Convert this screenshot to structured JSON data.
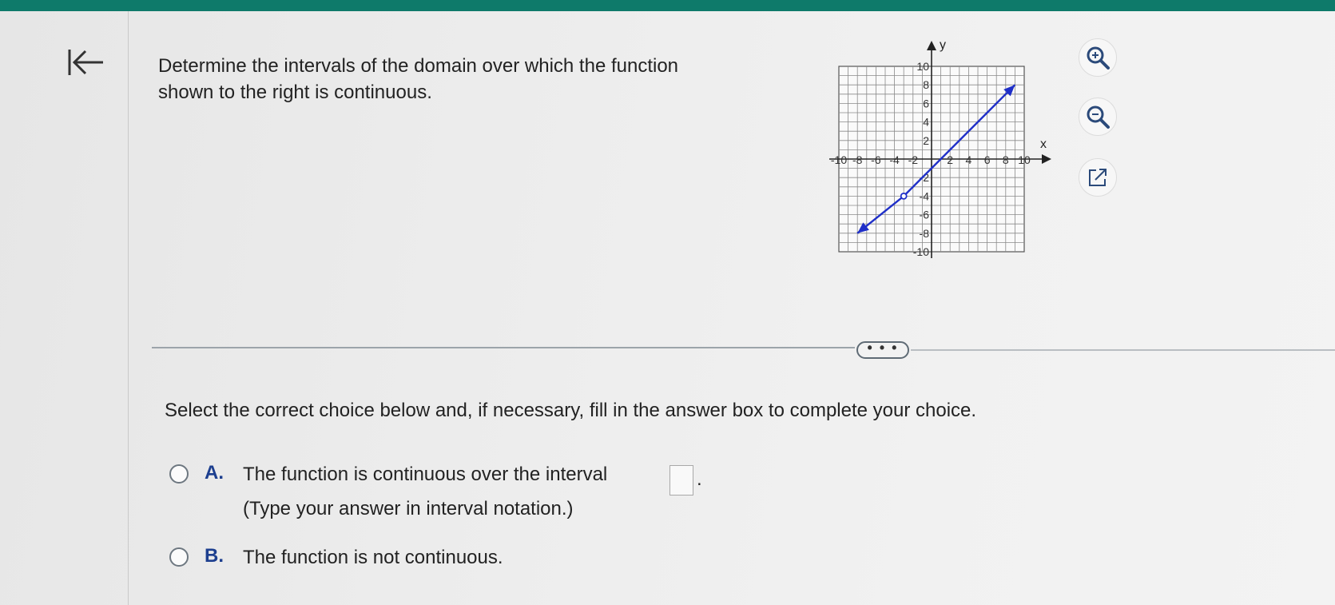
{
  "question": {
    "line1": "Determine the intervals of the domain over which the function",
    "line2": "shown to the right is continuous."
  },
  "instruction": "Select the correct choice below and, if necessary, fill in the answer box to complete your choice.",
  "more_label": "• • •",
  "choices": {
    "a": {
      "letter": "A.",
      "text": "The function is continuous over the interval",
      "hint": "(Type your answer in interval notation.)",
      "answer_value": "",
      "period": "."
    },
    "b": {
      "letter": "B.",
      "text": "The function is not continuous."
    }
  },
  "icons": {
    "back": "back-to-start-icon",
    "zoom_in": "zoom-in-icon",
    "zoom_out": "zoom-out-icon",
    "popout": "popout-icon"
  },
  "colors": {
    "top_bar": "#0e7a6a",
    "line": "#1f2fc8",
    "choice_letter": "#1d3f8f"
  },
  "chart_data": {
    "type": "line",
    "x_label": "x",
    "y_label": "y",
    "xlim": [
      -10,
      10
    ],
    "ylim": [
      -10,
      10
    ],
    "grid": true,
    "x_ticks": [
      "-10",
      "-8",
      "-6",
      "-4",
      "-2",
      "2",
      "4",
      "6",
      "8",
      "10"
    ],
    "y_ticks": [
      "10",
      "8",
      "6",
      "4",
      "2",
      "-2",
      "-4",
      "-6",
      "-8",
      "-10"
    ],
    "series": [
      {
        "points": [
          [
            -8,
            -8
          ],
          [
            -3,
            -4
          ],
          [
            -2,
            -3
          ],
          [
            9,
            8
          ]
        ],
        "arrow_start": true,
        "arrow_end": true,
        "open_point": [
          -3,
          -4
        ]
      }
    ]
  }
}
